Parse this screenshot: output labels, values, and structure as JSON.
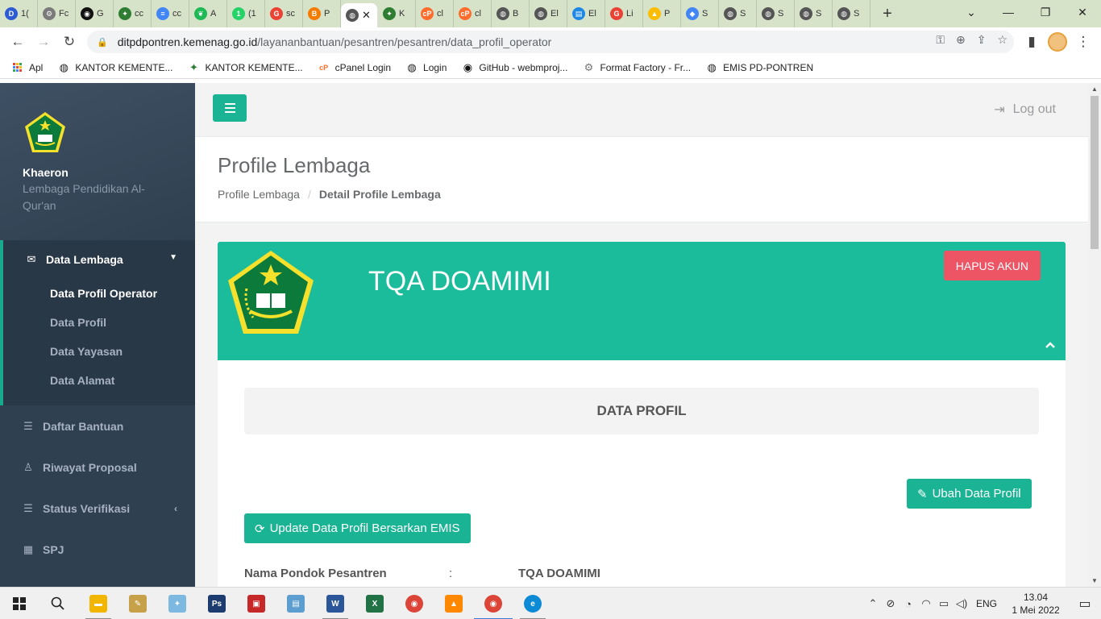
{
  "browser": {
    "tabs": [
      {
        "label": "1(",
        "icon": "d-app-icon",
        "color": "#2c5bd4",
        "glyph": "D"
      },
      {
        "label": "Fc",
        "icon": "tools-icon",
        "color": "#7a7a7a",
        "glyph": "⚙"
      },
      {
        "label": "G",
        "icon": "github-icon",
        "color": "#111111",
        "glyph": "◉"
      },
      {
        "label": "cc",
        "icon": "kemenag-icon",
        "color": "#2e7d32",
        "glyph": "✦"
      },
      {
        "label": "cc",
        "icon": "docs-icon",
        "color": "#4285f4",
        "glyph": "≡"
      },
      {
        "label": "A",
        "icon": "leaf-icon",
        "color": "#1db954",
        "glyph": "❦"
      },
      {
        "label": "(1",
        "icon": "whatsapp-icon",
        "color": "#25d366",
        "glyph": "1"
      },
      {
        "label": "sc",
        "icon": "google-icon",
        "color": "#ea4335",
        "glyph": "G"
      },
      {
        "label": "P",
        "icon": "blogger-icon",
        "color": "#f57c00",
        "glyph": "B"
      },
      {
        "label": "",
        "icon": "globe-icon",
        "color": "#555555",
        "glyph": "◍",
        "active": true
      },
      {
        "label": "K",
        "icon": "kemenag-icon",
        "color": "#2e7d32",
        "glyph": "✦"
      },
      {
        "label": "cl",
        "icon": "cpanel-icon",
        "color": "#ff6c2c",
        "glyph": "cP"
      },
      {
        "label": "cl",
        "icon": "cpanel-icon",
        "color": "#ff6c2c",
        "glyph": "cP"
      },
      {
        "label": "B",
        "icon": "globe-icon",
        "color": "#555555",
        "glyph": "◍"
      },
      {
        "label": "El",
        "icon": "globe-icon",
        "color": "#555555",
        "glyph": "◍"
      },
      {
        "label": "El",
        "icon": "chart-icon",
        "color": "#1e88e5",
        "glyph": "▤"
      },
      {
        "label": "Li",
        "icon": "google-icon",
        "color": "#ea4335",
        "glyph": "G"
      },
      {
        "label": "P",
        "icon": "drive-icon",
        "color": "#fbbc04",
        "glyph": "▲"
      },
      {
        "label": "S",
        "icon": "adsense-icon",
        "color": "#4285f4",
        "glyph": "◆"
      },
      {
        "label": "S",
        "icon": "globe-icon",
        "color": "#555555",
        "glyph": "◍"
      },
      {
        "label": "S",
        "icon": "globe-icon",
        "color": "#555555",
        "glyph": "◍"
      },
      {
        "label": "S",
        "icon": "globe-icon",
        "color": "#555555",
        "glyph": "◍"
      },
      {
        "label": "S",
        "icon": "globe-icon",
        "color": "#555555",
        "glyph": "◍"
      }
    ],
    "url_host": "ditpdpontren.kemenag.go.id",
    "url_path": "/layananbantuan/pesantren/pesantren/data_profil_operator",
    "bookmarks": [
      {
        "label": "Apl",
        "icon": "apps-grid-icon"
      },
      {
        "label": "KANTOR KEMENTE...",
        "icon": "globe-icon"
      },
      {
        "label": "KANTOR KEMENTE...",
        "icon": "kemenag-icon"
      },
      {
        "label": "cPanel Login",
        "icon": "cpanel-icon"
      },
      {
        "label": "Login",
        "icon": "globe-icon"
      },
      {
        "label": "GitHub - webmproj...",
        "icon": "github-icon"
      },
      {
        "label": "Format Factory - Fr...",
        "icon": "format-factory-icon"
      },
      {
        "label": "EMIS PD-PONTREN",
        "icon": "globe-icon"
      }
    ]
  },
  "sidebar": {
    "user_name": "Khaeron",
    "user_org": "Lembaga Pendidikan Al-Qur'an",
    "menu_group_title": "Data Lembaga",
    "submenu": [
      {
        "label": "Data Profil Operator",
        "active": true
      },
      {
        "label": "Data Profil"
      },
      {
        "label": "Data Yayasan"
      },
      {
        "label": "Data Alamat"
      }
    ],
    "menu_items": [
      {
        "label": "Daftar Bantuan",
        "icon": "list-icon"
      },
      {
        "label": "Riwayat Proposal",
        "icon": "user-icon"
      },
      {
        "label": "Status Verifikasi",
        "icon": "list-icon"
      },
      {
        "label": "SPJ",
        "icon": "grid-icon"
      }
    ]
  },
  "topbar": {
    "logout_label": "Log out"
  },
  "heading": {
    "title": "Profile Lembaga",
    "breadcrumb_root": "Profile Lembaga",
    "breadcrumb_current": "Detail Profile Lembaga"
  },
  "banner": {
    "institution_name": "TQA DOAMIMI",
    "delete_label": "HAPUS AKUN"
  },
  "profile": {
    "section_title": "DATA PROFIL",
    "edit_label": "Ubah Data Profil",
    "update_label": "Update Data Profil Bersarkan EMIS",
    "fields": [
      {
        "label": "Nama Pondok Pesantren",
        "colon": ":",
        "value": "TQA DOAMIMI"
      }
    ]
  },
  "taskbar": {
    "language": "ENG",
    "time": "13.04",
    "date": "1 Mei 2022"
  },
  "colors": {
    "accent": "#1ab394",
    "banner": "#1abc9c",
    "danger": "#ed5565",
    "sidebar": "#2f4050"
  }
}
